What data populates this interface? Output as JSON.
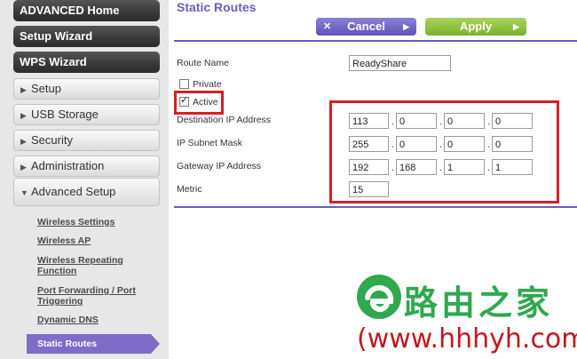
{
  "sidebar": {
    "advanced_home": "ADVANCED Home",
    "setup_wizard": "Setup Wizard",
    "wps_wizard": "WPS Wizard",
    "items": [
      {
        "label": "Setup"
      },
      {
        "label": "USB Storage"
      },
      {
        "label": "Security"
      },
      {
        "label": "Administration"
      },
      {
        "label": "Advanced Setup"
      }
    ],
    "sublinks": [
      {
        "label": "Wireless Settings"
      },
      {
        "label": "Wireless AP"
      },
      {
        "label": "Wireless Repeating Function"
      },
      {
        "label": "Port Forwarding / Port Triggering"
      },
      {
        "label": "Dynamic DNS"
      },
      {
        "label": "Static Routes"
      }
    ],
    "active_color": "#7d6cc8"
  },
  "main": {
    "title": "Static Routes",
    "cancel_label": "Cancel",
    "apply_label": "Apply",
    "route_name_label": "Route Name",
    "route_name_value": "ReadyShare",
    "private_label": "Private",
    "private_checked": false,
    "active_label": "Active",
    "active_checked": true,
    "dest_ip_label": "Destination IP Address",
    "dest_ip": [
      "113",
      "0",
      "0",
      "0"
    ],
    "subnet_label": "IP Subnet Mask",
    "subnet": [
      "255",
      "0",
      "0",
      "0"
    ],
    "gateway_label": "Gateway IP Address",
    "gateway": [
      "192",
      "168",
      "1",
      "1"
    ],
    "metric_label": "Metric",
    "metric_value": "15"
  },
  "watermark": {
    "cn_text": "路由之家",
    "url": "(www.hhhyh.com)"
  },
  "colors": {
    "accent": "#6a5ec2",
    "apply_green": "#7ab12b",
    "highlight_red": "#d81e26",
    "watermark_green": "#2fa84e"
  }
}
